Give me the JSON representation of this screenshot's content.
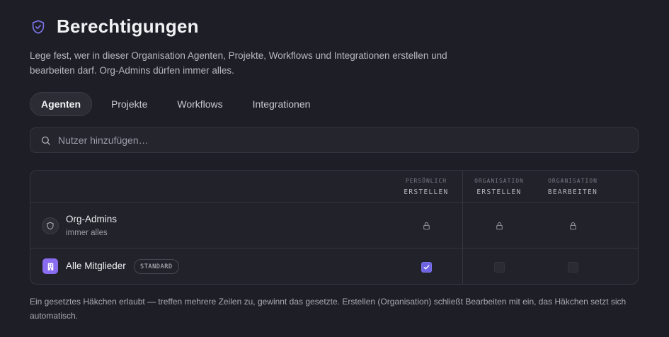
{
  "header": {
    "icon": "shield-icon",
    "title": "Berechtigungen",
    "accent_color": "#7b73e8"
  },
  "description": "Lege fest, wer in dieser Organisation Agenten, Projekte, Workflows und Integrationen erstellen und bearbeiten darf. Org-Admins dürfen immer alles.",
  "tabs": [
    {
      "label": "Agenten",
      "active": true
    },
    {
      "label": "Projekte",
      "active": false
    },
    {
      "label": "Workflows",
      "active": false
    },
    {
      "label": "Integrationen",
      "active": false
    }
  ],
  "search": {
    "icon": "search-icon",
    "placeholder": "Nutzer hinzufügen…",
    "value": ""
  },
  "table": {
    "columns": [
      {
        "group": "PERSÖNLICH",
        "label": "ERSTELLEN"
      },
      {
        "group": "ORGANISATION",
        "label": "ERSTELLEN"
      },
      {
        "group": "ORGANISATION",
        "label": "BEARBEITEN"
      }
    ],
    "rows": [
      {
        "name": "Org-Admins",
        "subtitle": "immer alles",
        "avatar_icon": "shield-icon",
        "cells": [
          "locked",
          "locked",
          "locked"
        ]
      },
      {
        "name": "Alle Mitglieder",
        "badge": "STANDARD",
        "avatar_icon": "building-icon",
        "cells": [
          "checked",
          "unchecked",
          "unchecked"
        ]
      }
    ]
  },
  "footer_note": "Ein gesetztes Häkchen erlaubt — treffen mehrere Zeilen zu, gewinnt das gesetzte. Erstellen (Organisation) schließt Bearbeiten mit ein, das Häkchen setzt sich automatisch.",
  "colors": {
    "background": "#1e1f26",
    "checkbox_checked": "#6e63e3",
    "member_avatar": "#8a6cf0"
  }
}
